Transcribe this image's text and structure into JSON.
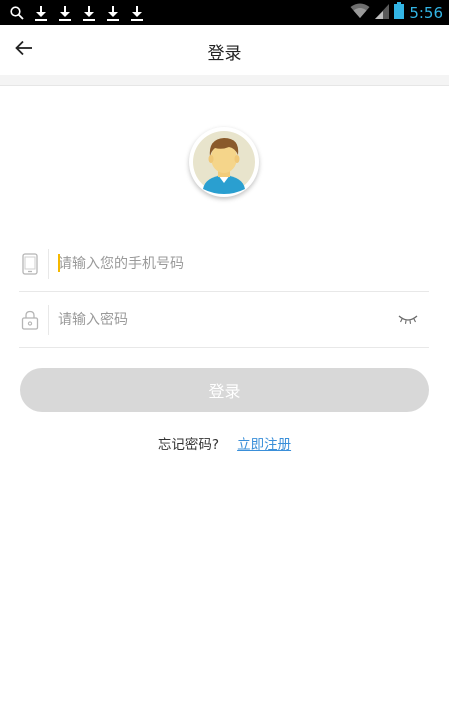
{
  "status_bar": {
    "time": "5:56",
    "icons": [
      "search-icon",
      "download-icon",
      "download-icon",
      "download-icon",
      "download-icon",
      "download-icon",
      "wifi-icon",
      "signal-icon",
      "battery-icon"
    ],
    "time_color": "#33b5e5"
  },
  "app_bar": {
    "title": "登录",
    "back_icon": "arrow-left-icon"
  },
  "avatar": {
    "icon": "user-avatar-icon"
  },
  "form": {
    "phone": {
      "icon": "phone-icon",
      "placeholder": "请输入您的手机号码",
      "value": ""
    },
    "password": {
      "icon": "lock-icon",
      "placeholder": "请输入密码",
      "value": "",
      "toggle_icon": "eye-closed-icon"
    }
  },
  "login_button": {
    "label": "登录",
    "disabled_color": "#d8d8d8"
  },
  "links": {
    "forgot": "忘记密码?",
    "register": "立即注册",
    "register_color": "#3a8fd9"
  }
}
